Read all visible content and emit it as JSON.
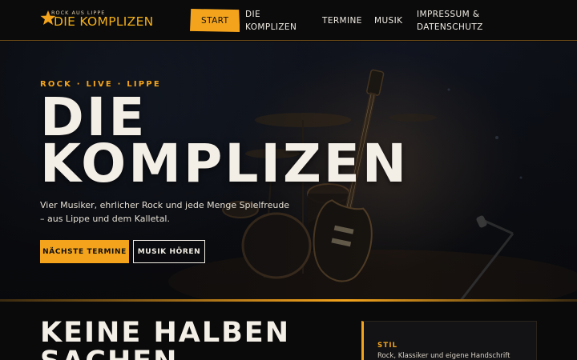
{
  "brand": {
    "tagline": "Rock aus Lippe",
    "name": "DIE KOMPLIZEN"
  },
  "nav": {
    "items": [
      {
        "label": "Start",
        "active": true
      },
      {
        "label": "Die\nKomplizen"
      },
      {
        "label": "Termine"
      },
      {
        "label": "Musik"
      },
      {
        "label": "Impressum &\nDatenschutz"
      }
    ]
  },
  "hero": {
    "kicker": "ROCK · LIVE · LIPPE",
    "title_line1": "DIE",
    "title_line2": "KOMPLIZEN",
    "text": "Vier Musiker, ehrlicher Rock und jede Menge Spielfreude – aus Lippe und dem Kalletal.",
    "primary_button": "NÄCHSTE TERMINE",
    "secondary_button": "MUSIK HÖREN"
  },
  "section": {
    "title_line1": "KEINE HALBEN",
    "title_line2": "SACHEN"
  },
  "card": {
    "label": "STIL",
    "text": "Rock, Klassiker und eigene Handschrift"
  },
  "colors": {
    "accent": "#f4a41c",
    "background": "#0a0a0b",
    "text": "#f1ece3"
  }
}
